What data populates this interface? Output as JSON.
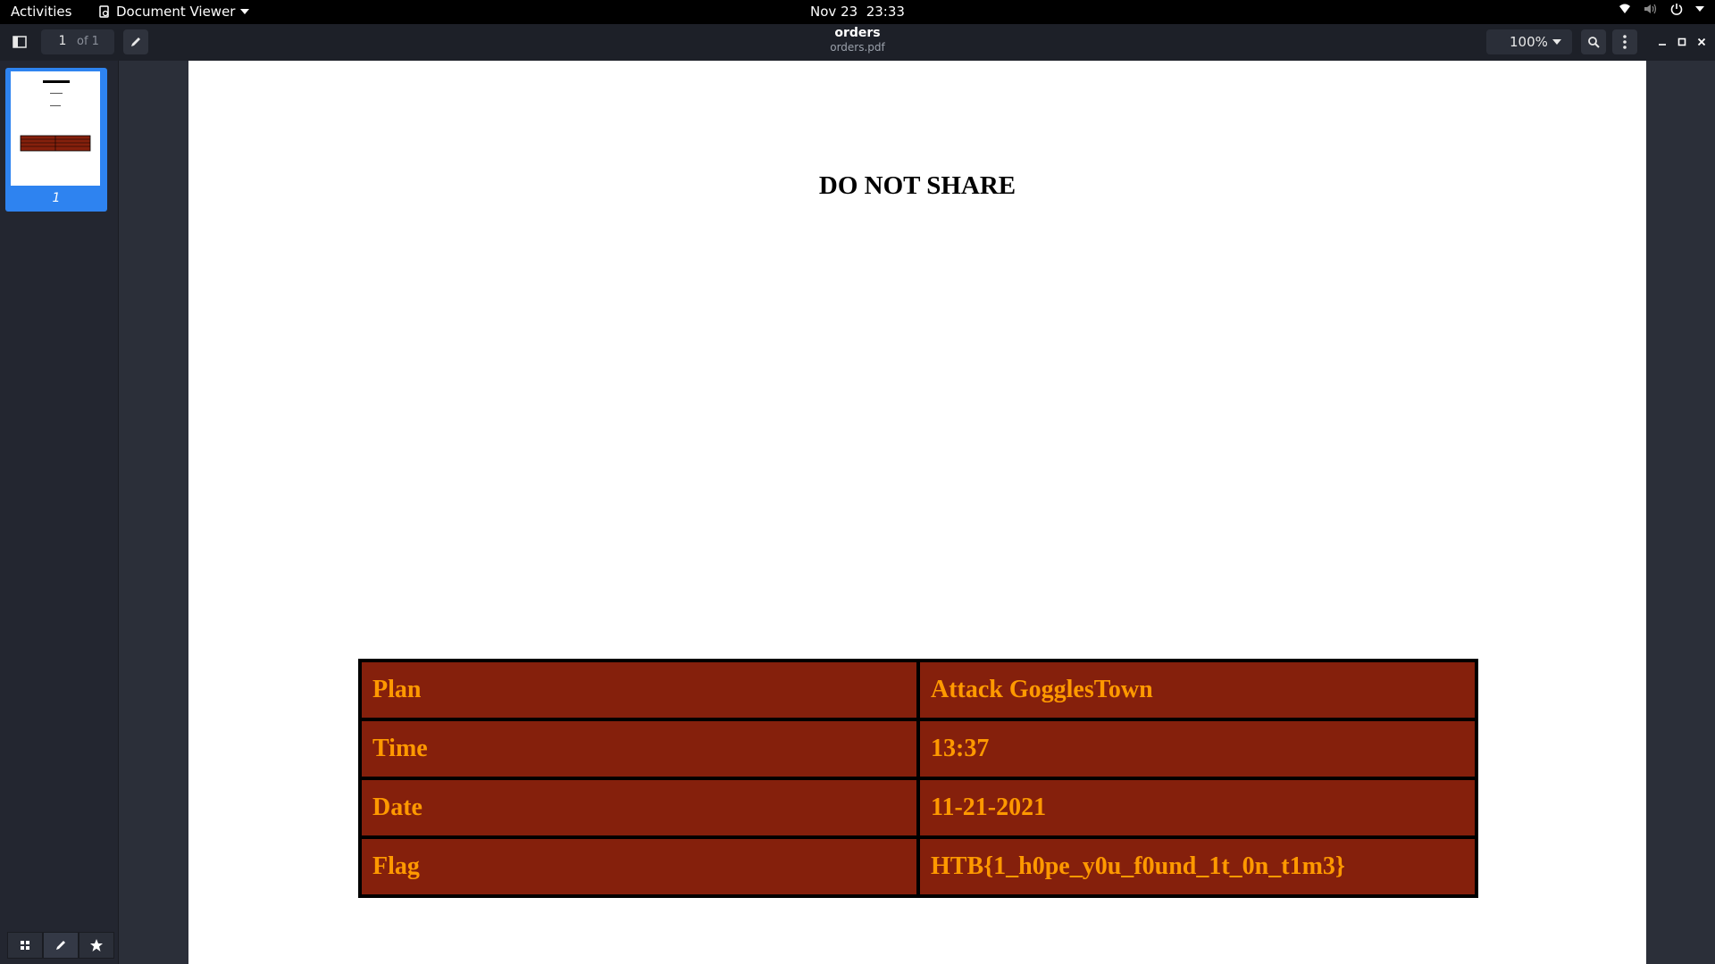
{
  "topbar": {
    "activities": "Activities",
    "app_name": "Document Viewer",
    "date": "Nov 23",
    "time": "23:33"
  },
  "header": {
    "page_current": "1",
    "page_total": "of 1",
    "title": "orders",
    "subtitle": "orders.pdf",
    "zoom": "100%"
  },
  "sidebar": {
    "thumbnail_label": "1"
  },
  "document": {
    "heading": "DO NOT SHARE",
    "rows": [
      {
        "label": "Plan",
        "value": "Attack GogglesTown"
      },
      {
        "label": "Time",
        "value": "13:37"
      },
      {
        "label": "Date",
        "value": "11-21-2021"
      },
      {
        "label": "Flag",
        "value": "HTB{1_h0pe_y0u_f0und_1t_0n_t1m3}"
      }
    ]
  },
  "colors": {
    "table_bg": "#85200c",
    "table_text": "#ff9900",
    "selection": "#2e83f0"
  }
}
